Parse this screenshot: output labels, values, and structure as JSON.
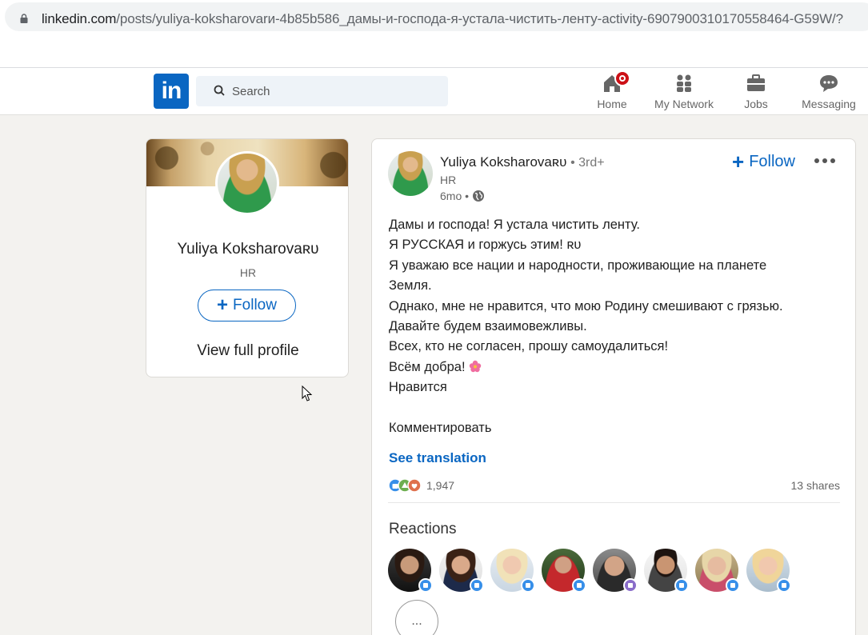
{
  "browser": {
    "url_host": "linkedin.com",
    "url_path": "/posts/yuliya-koksharovarи-4b85b586_дамы-и-господа-я-устала-чистить-ленту-activity-6907900310170558464-G59W/?"
  },
  "nav": {
    "search_placeholder": "Search",
    "items": [
      {
        "label": "Home",
        "icon": "home-icon"
      },
      {
        "label": "My Network",
        "icon": "network-icon"
      },
      {
        "label": "Jobs",
        "icon": "briefcase-icon"
      },
      {
        "label": "Messaging",
        "icon": "messaging-icon"
      }
    ]
  },
  "profile": {
    "name": "Yuliya Koksharovaʀᴜ",
    "headline": "HR",
    "follow_label": "Follow",
    "view_profile_label": "View full profile"
  },
  "post": {
    "author": "Yuliya Koksharovaʀᴜ",
    "degree": "• 3rd+",
    "headline": "HR",
    "time": "6mo •",
    "follow_label": "Follow",
    "lines": [
      "Дамы и господа! Я устала чистить ленту.",
      "Я РУССКАЯ и горжусь этим! ʀᴜ",
      "Я уважаю все нации и народности, проживающие на планете",
      "Земля.",
      "Однако, мне не нравится, что мою Родину смешивают с грязью.",
      "Давайте будем взаимовежливы.",
      "Всех, кто не согласен, прошу самоудалиться!",
      "Всём добра!",
      "Нравится",
      "",
      "Комментировать"
    ],
    "see_translation": "See translation",
    "reaction_count": "1,947",
    "shares": "13 shares",
    "reactions_title": "Reactions",
    "more_reactors": "..."
  },
  "colors": {
    "brand": "#0a66c2",
    "notification": "#cc1016",
    "like": "#378fe9"
  }
}
